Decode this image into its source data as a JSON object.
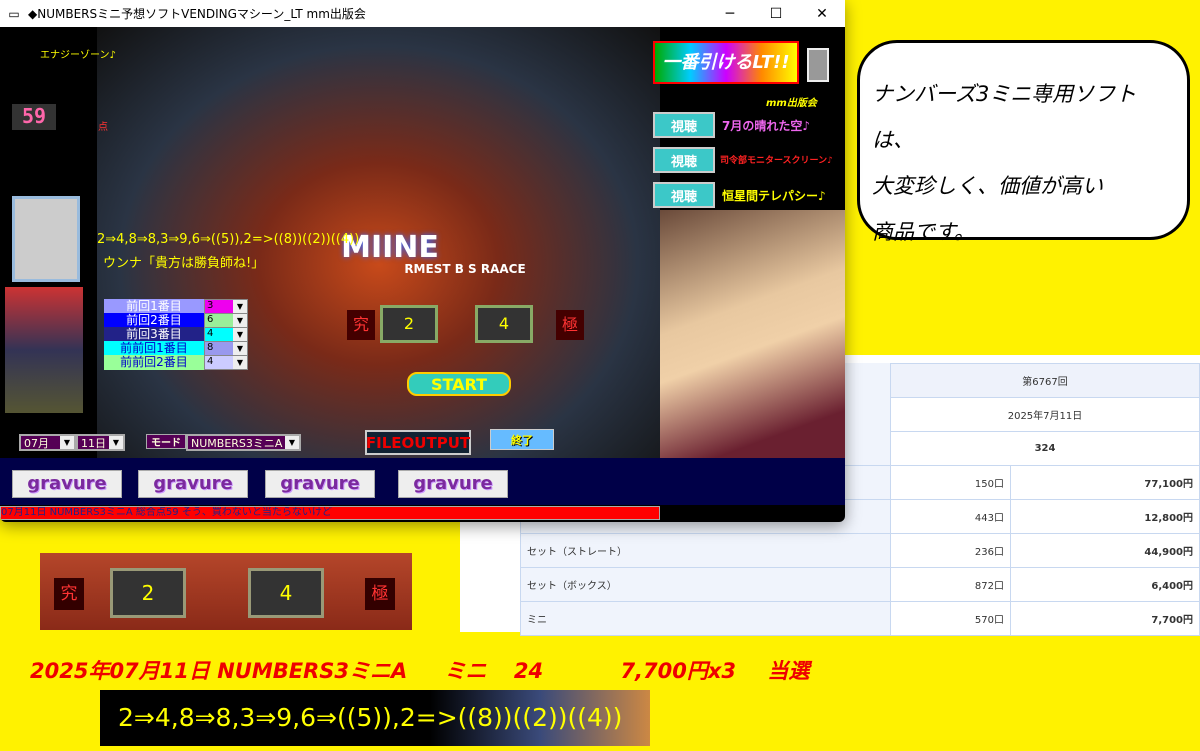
{
  "window": {
    "title": "◆NUMBERSミニ予想ソフトVENDINGマシーン_LT  mm出版会",
    "minimize": "─",
    "maximize": "☐",
    "close": "✕"
  },
  "left": {
    "energy_zone": "エナジーゾーン♪",
    "score": "59",
    "score_unit": "点"
  },
  "prediction": {
    "sequence": "2⇒4,8⇒8,3⇒9,6⇒((5)),2=>((8))((2))((4))",
    "quote": "ウンナ「貴方は勝負師ね!」"
  },
  "previous": [
    {
      "label": "前回1番目",
      "value": "3",
      "color": "#ee00ee"
    },
    {
      "label": "前回2番目",
      "value": "6",
      "color": "#90ee90"
    },
    {
      "label": "前回3番目",
      "value": "4",
      "color": "#00ffff"
    },
    {
      "label": "前前回1番目",
      "value": "8",
      "color": "#9999ee"
    },
    {
      "label": "前前回2番目",
      "value": "4",
      "color": "#ccccff"
    }
  ],
  "machine": {
    "title": "MIINE",
    "subtitle": "RMEST B S RAACE",
    "left_kanji": "究",
    "right_kanji": "極",
    "reel1": "2",
    "reel2": "4",
    "start": "START"
  },
  "controls": {
    "month": "07月",
    "day": "11日",
    "mode_label": "モード",
    "mode": "NUMBERS3ミニA",
    "file_output": "FILEOUTPUT",
    "exit": "終了"
  },
  "gravure": [
    "gravure",
    "gravure",
    "gravure",
    "gravure"
  ],
  "status": "07月11日 NUMBERS3ミニA  総合点59  そう、買わないと当たらないけど",
  "right": {
    "logo": "一番引けるLT!!",
    "publisher": "mm出版会",
    "listen_label": "視聴",
    "tracks": [
      {
        "title": "7月の晴れた空♪",
        "color": "#ee66ee"
      },
      {
        "title": "司令部モニタースクリーン♪",
        "color": "#ff2222"
      },
      {
        "title": "恒星間テレパシー♪",
        "color": "#ffff00"
      }
    ]
  },
  "bubble": {
    "text": [
      "ナンバーズ3ミニ専用ソフトは、",
      "大変珍しく、価値が高い",
      "商品です。"
    ]
  },
  "results": {
    "round": "第6767回",
    "date": "2025年7月11日",
    "number": "324",
    "rows": [
      {
        "name": "",
        "count": "150口",
        "prize": "77,100円"
      },
      {
        "name": "",
        "count": "443口",
        "prize": "12,800円"
      },
      {
        "name": "セット（ストレート）",
        "count": "236口",
        "prize": "44,900円"
      },
      {
        "name": "セット（ボックス）",
        "count": "872口",
        "prize": "6,400円"
      },
      {
        "name": "ミニ",
        "count": "570口",
        "prize": "7,700円"
      }
    ]
  },
  "crop": {
    "left_kanji": "究",
    "reel1": "2",
    "reel2": "4",
    "right_kanji": "極"
  },
  "result_line": {
    "date": "2025年07月11日",
    "mode": "NUMBERS3ミニA",
    "type": "ミニ",
    "number": "24",
    "prize": "7,700円x3",
    "verdict": "当選"
  },
  "banner": "2⇒4,8⇒8,3⇒9,6⇒((5)),2=>((8))((2))((4))"
}
